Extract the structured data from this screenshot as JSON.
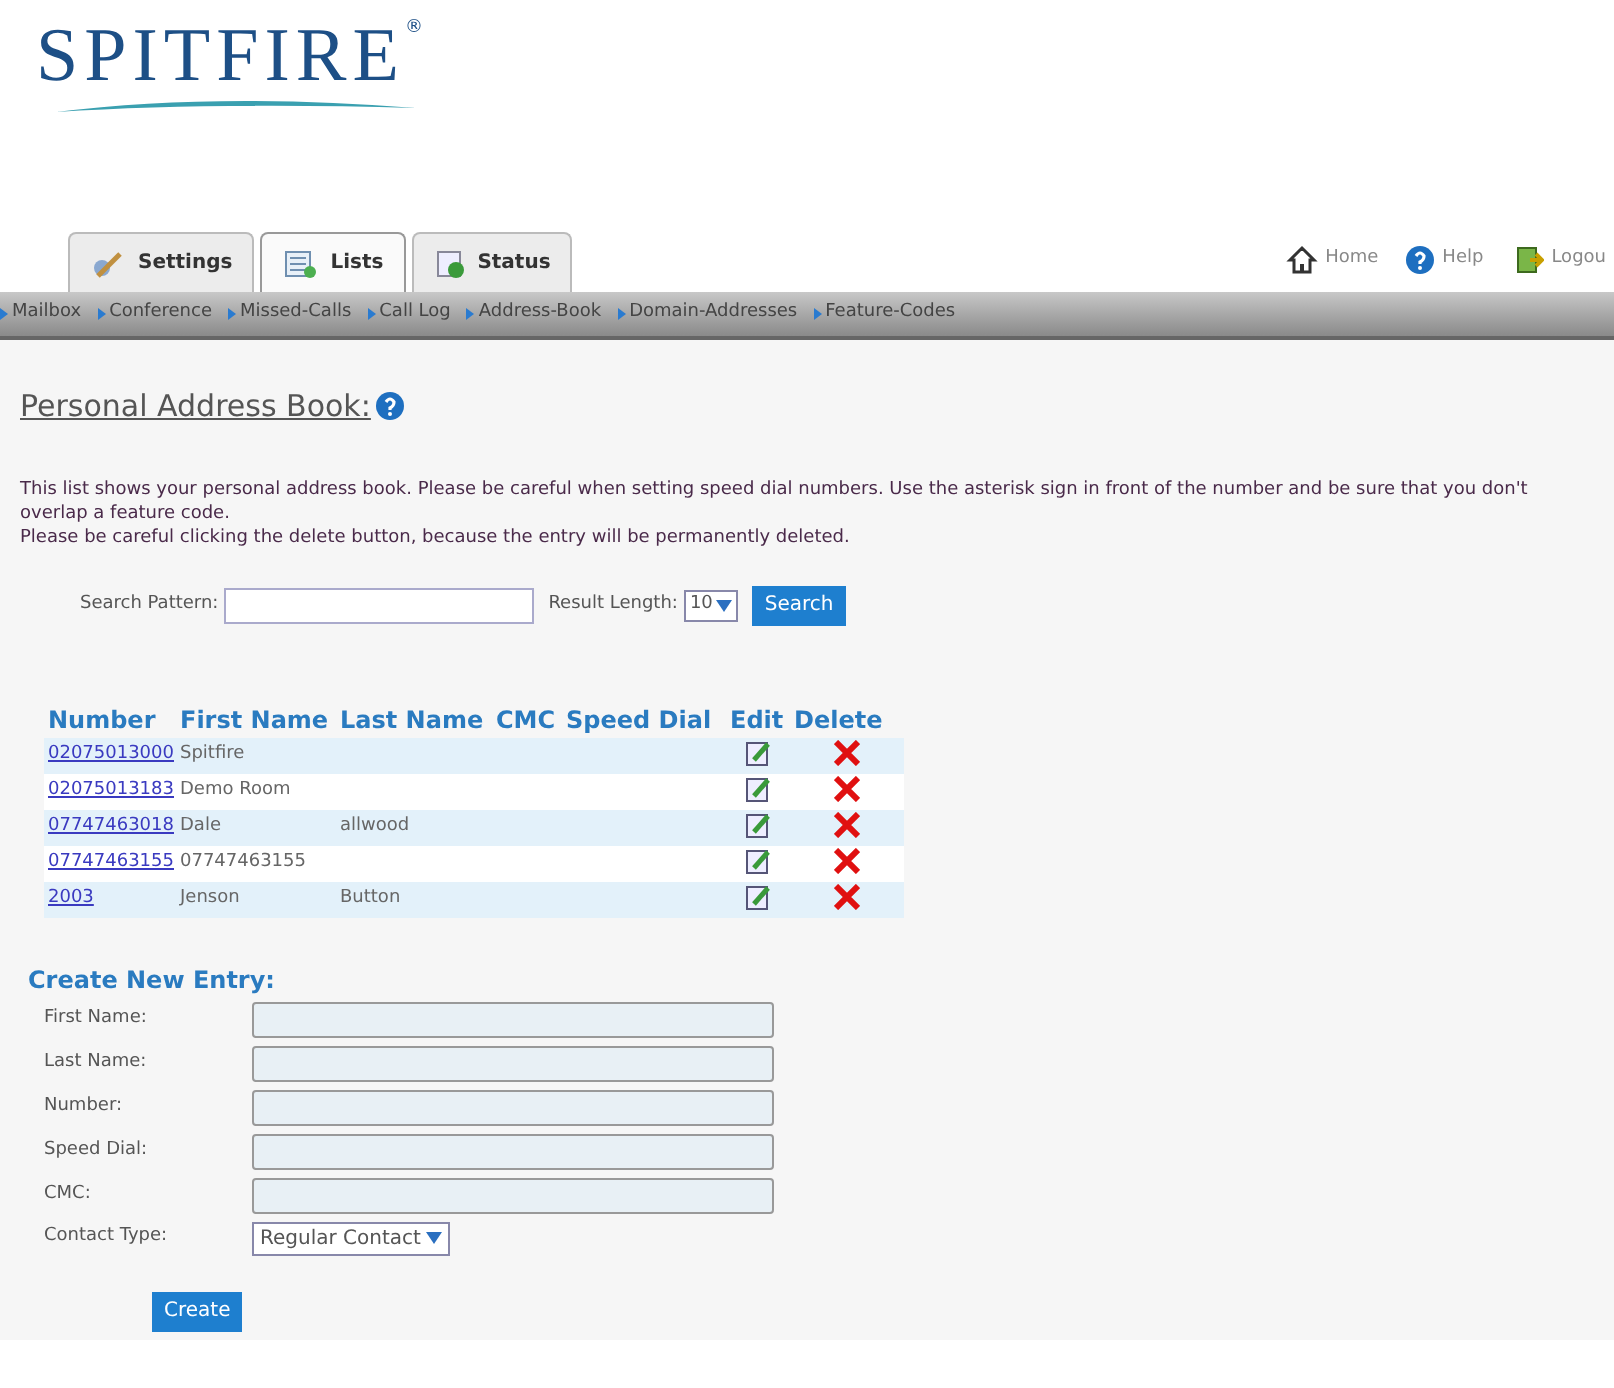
{
  "logo": {
    "text": "SPITFIRE",
    "mark": "®"
  },
  "top_links": [
    {
      "kind": "home",
      "label": "Home"
    },
    {
      "kind": "help",
      "label": "Help"
    },
    {
      "kind": "logout",
      "label": "Logou"
    }
  ],
  "tabs": [
    {
      "kind": "settings",
      "label": "Settings",
      "selected": false
    },
    {
      "kind": "lists",
      "label": "Lists",
      "selected": true
    },
    {
      "kind": "status",
      "label": "Status",
      "selected": false
    }
  ],
  "nav": [
    "Mailbox",
    "Conference",
    "Missed-Calls",
    "Call Log",
    "Address-Book",
    "Domain-Addresses",
    "Feature-Codes"
  ],
  "heading": "Personal Address Book:",
  "intro": [
    "This list shows your personal address book. Please be careful when setting speed dial numbers. Use the asterisk sign in front of the number and be sure that you don't overlap a feature code.",
    "Please be careful clicking the delete button, because the entry will be permanently deleted."
  ],
  "search": {
    "label": "Search Pattern:",
    "length_label": "Result Length:",
    "length_value": "10",
    "button": "Search"
  },
  "table": {
    "columns": [
      "Number",
      "First Name",
      "Last Name",
      "CMC",
      "Speed Dial",
      "Edit",
      "Delete"
    ],
    "rows": [
      {
        "number": "02075013000",
        "first": "Spitfire",
        "last": ""
      },
      {
        "number": "02075013183",
        "first": "Demo Room",
        "last": ""
      },
      {
        "number": "07747463018",
        "first": "Dale",
        "last": "allwood"
      },
      {
        "number": "07747463155",
        "first": "07747463155",
        "last": ""
      },
      {
        "number": "2003",
        "first": "Jenson",
        "last": "Button"
      }
    ]
  },
  "create": {
    "title": "Create New Entry:",
    "fields": [
      {
        "kind": "text",
        "label": "First Name:"
      },
      {
        "kind": "text",
        "label": "Last Name:"
      },
      {
        "kind": "text",
        "label": "Number:"
      },
      {
        "kind": "text",
        "label": "Speed Dial:"
      },
      {
        "kind": "text",
        "label": "CMC:"
      },
      {
        "kind": "select",
        "label": "Contact Type:",
        "value": "Regular Contact"
      }
    ],
    "button": "Create"
  }
}
